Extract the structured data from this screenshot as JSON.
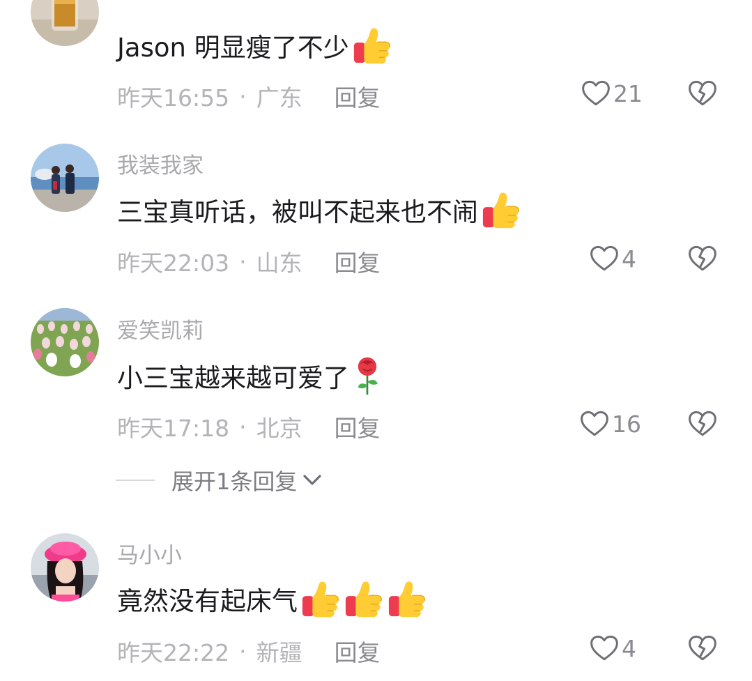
{
  "comments": [
    {
      "username": "",
      "text": "Jason 明显瘦了不少",
      "time": "昨天16:55",
      "location": "广东",
      "reply_label": "回复",
      "likes": "21",
      "emojis": [
        "thumbs-up"
      ]
    },
    {
      "username": "我装我家",
      "text": "三宝真听话，被叫不起来也不闹",
      "time": "昨天22:03",
      "location": "山东",
      "reply_label": "回复",
      "likes": "4",
      "emojis": [
        "thumbs-up"
      ]
    },
    {
      "username": "爱笑凯莉",
      "text": "小三宝越来越可爱了",
      "time": "昨天17:18",
      "location": "北京",
      "reply_label": "回复",
      "likes": "16",
      "emojis": [
        "rose"
      ]
    },
    {
      "username": "马小小",
      "text": "竟然没有起床气",
      "time": "昨天22:22",
      "location": "新疆",
      "reply_label": "回复",
      "likes": "4",
      "emojis": [
        "thumbs-up",
        "thumbs-up",
        "thumbs-up"
      ]
    }
  ],
  "expand_replies_label": "展开1条回复",
  "separator": "·",
  "colors": {
    "username": "#a8a8ad",
    "text": "#1b1b1f",
    "meta": "#b3b3b8",
    "action": "#8a8a90"
  }
}
